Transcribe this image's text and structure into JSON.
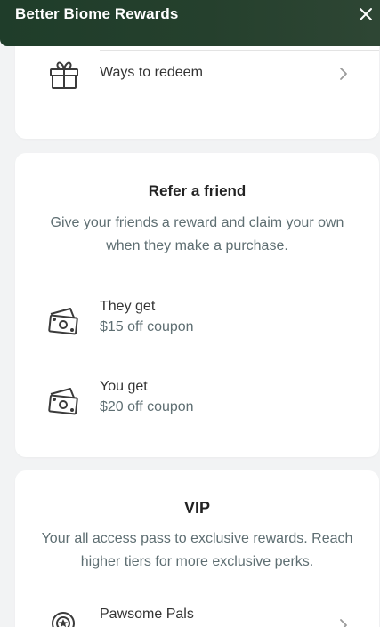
{
  "header": {
    "title": "Better Biome Rewards",
    "close_icon": "close-icon"
  },
  "redeem": {
    "label": "Ways to redeem",
    "icon": "gift-icon"
  },
  "refer": {
    "title": "Refer a friend",
    "description": "Give your friends a reward and claim your own when they make a purchase.",
    "rewards": [
      {
        "who": "They get",
        "what": "$15 off coupon",
        "icon": "cash-icon"
      },
      {
        "who": "You get",
        "what": "$20 off coupon",
        "icon": "cash-icon"
      }
    ]
  },
  "vip": {
    "title": "VIP",
    "description": "Your all access pass to exclusive rewards. Reach higher tiers for more exclusive perks.",
    "tiers": [
      {
        "label": "Pawsome Pals",
        "icon": "badge-icon"
      }
    ]
  },
  "colors": {
    "header_bg": "#24402c",
    "accent_text": "#5e6e72",
    "page_bg": "#f2f3f4"
  }
}
